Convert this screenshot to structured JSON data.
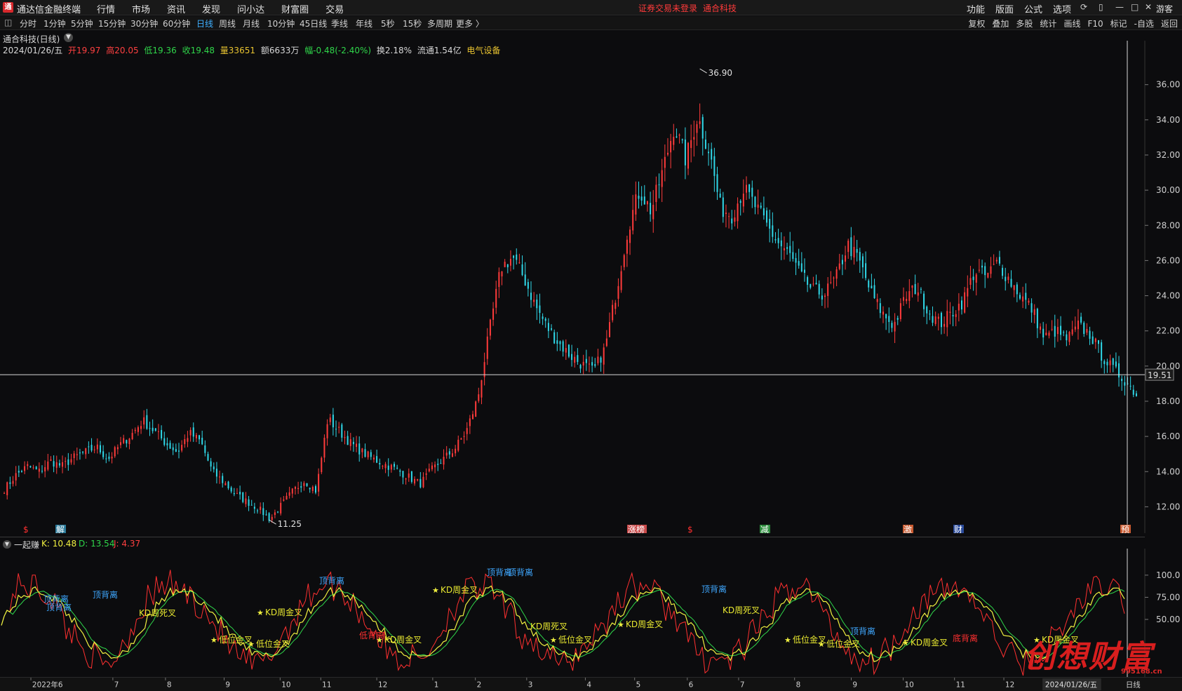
{
  "app": {
    "title": "通达信金融终端",
    "logo": "通",
    "menus": [
      "行情",
      "市场",
      "资讯",
      "发现",
      "问小达",
      "财富圈",
      "交易"
    ],
    "login_notice": "证券交易未登录",
    "stock_name": "通合科技",
    "right_menus": [
      "功能",
      "版面",
      "公式",
      "选项"
    ],
    "guest": "游客",
    "window_icons": [
      "refresh-icon",
      "phone-icon",
      "minimize-icon",
      "maximize-icon",
      "close-icon"
    ]
  },
  "toolbar": {
    "periods": [
      "分时",
      "1分钟",
      "5分钟",
      "15分钟",
      "30分钟",
      "60分钟",
      "日线",
      "周线",
      "月线",
      "10分钟",
      "45日线",
      "季线",
      "年线",
      "5秒",
      "15秒",
      "多周期",
      "更多 〉"
    ],
    "active": "日线",
    "right": [
      "复权",
      "叠加",
      "多股",
      "统计",
      "画线",
      "F10",
      "标记",
      "-自选",
      "返回"
    ]
  },
  "header": {
    "stock_title": "通合科技(日线)",
    "date": "2024/01/26/五",
    "open": "开19.97",
    "high": "高20.05",
    "low": "低19.36",
    "close": "收19.48",
    "volume": "量33651",
    "amount": "额6633万",
    "change": "幅-0.48(-2.40%)",
    "turnover": "换2.18%",
    "float": "流通1.54亿",
    "sector": "电气设备"
  },
  "chart_data": [
    {
      "type": "candlestick",
      "price_axis_ticks": [
        12,
        14,
        16,
        18,
        20,
        22,
        24,
        26,
        28,
        30,
        32,
        34,
        36
      ],
      "price_axis_labels": [
        "12.00",
        "14.00",
        "16.00",
        "18.00",
        "20.00",
        "22.00",
        "24.00",
        "26.00",
        "28.00",
        "30.00",
        "32.00",
        "34.00",
        "36.00"
      ],
      "ylim": [
        10.5,
        38.5
      ],
      "up_color": "#ff3b3b",
      "down_color": "#2fd8e8",
      "max_label": "36.90",
      "min_label": "11.25",
      "crosshair_label": "19.51",
      "crosshair_price": 19.51,
      "months": [
        "2022年6",
        "7",
        "8",
        "9",
        "10",
        "11",
        "12",
        "1",
        "2",
        "3",
        "4",
        "5",
        "6",
        "7",
        "8",
        "9",
        "10",
        "11",
        "12"
      ],
      "last_date_label": "2024/01/26/五",
      "period_label": "日线",
      "close_path": [
        13.0,
        13.8,
        14.3,
        14.0,
        14.6,
        14.3,
        14.8,
        15.1,
        15.4,
        14.7,
        15.5,
        16.1,
        16.9,
        16.3,
        15.6,
        15.1,
        16.2,
        15.7,
        14.0,
        13.4,
        12.7,
        12.3,
        11.9,
        11.3,
        12.1,
        12.9,
        13.5,
        12.9,
        17.0,
        16.3,
        15.6,
        15.1,
        14.7,
        14.4,
        14.1,
        13.7,
        13.3,
        14.1,
        14.7,
        15.3,
        16.3,
        18.2,
        22.0,
        25.6,
        26.2,
        25.0,
        23.4,
        22.2,
        21.3,
        20.6,
        20.1,
        19.7,
        21.0,
        24.3,
        27.9,
        30.0,
        28.8,
        31.1,
        33.7,
        31.7,
        34.2,
        32.3,
        29.0,
        28.6,
        30.1,
        29.1,
        28.0,
        27.0,
        26.3,
        25.1,
        24.3,
        24.1,
        25.0,
        26.9,
        26.0,
        24.2,
        23.0,
        22.3,
        23.9,
        24.5,
        23.1,
        22.4,
        23.0,
        23.7,
        25.4,
        25.1,
        25.9,
        24.9,
        24.0,
        23.2,
        21.6,
        22.0,
        21.5,
        22.3,
        21.8,
        20.6,
        19.8,
        19.2,
        18.4
      ],
      "index_labels": [
        {
          "text": "$",
          "color": "#ff3030",
          "bg": ""
        },
        {
          "text": "解",
          "color": "#ffffff",
          "bg": "#2a7a9a"
        },
        {
          "text": "涨榜",
          "color": "#ffffff",
          "bg": "#c84a4a"
        },
        {
          "text": "$",
          "color": "#ff3030",
          "bg": ""
        },
        {
          "text": "减",
          "color": "#ffffff",
          "bg": "#2a8a3a"
        },
        {
          "text": "激",
          "color": "#ffffff",
          "bg": "#c85a30"
        },
        {
          "text": "财",
          "color": "#ffffff",
          "bg": "#2a4a9a"
        },
        {
          "text": "预",
          "color": "#ffffff",
          "bg": "#c85a30"
        }
      ]
    },
    {
      "type": "line",
      "name": "一起赚",
      "series": [
        {
          "name": "K",
          "label": "K: 10.48",
          "color": "#f0f040",
          "value": 10.48
        },
        {
          "name": "D",
          "label": "D: 13.54",
          "color": "#2fd64a",
          "value": 13.54
        },
        {
          "name": "J",
          "label": "J: 4.37",
          "color": "#ff3030",
          "value": 4.37
        }
      ],
      "y_ticks": [
        50,
        75,
        100
      ],
      "y_labels": [
        "50.00",
        "75.00",
        "100.0"
      ],
      "ylim": [
        -15,
        130
      ],
      "annotations": [
        {
          "text": "顶背离",
          "color": "#3fa8ff"
        },
        {
          "text": "顶背离",
          "color": "#3fa8ff"
        },
        {
          "text": "顶背离",
          "color": "#3fa8ff"
        },
        {
          "text": "KD周死叉",
          "color": "#e8e830"
        },
        {
          "text": "低位金叉",
          "color": "#e8e830"
        },
        {
          "text": "低位金叉",
          "color": "#e8e830"
        },
        {
          "text": "KD周金叉",
          "color": "#e8e830"
        },
        {
          "text": "顶背离",
          "color": "#3fa8ff"
        },
        {
          "text": "低背离",
          "color": "#ff3030"
        },
        {
          "text": "KD周金叉",
          "color": "#e8e830"
        },
        {
          "text": "顶背离",
          "color": "#3fa8ff"
        },
        {
          "text": "顶背离",
          "color": "#3fa8ff"
        },
        {
          "text": "KD周金叉",
          "color": "#e8e830"
        },
        {
          "text": "KD周死叉",
          "color": "#e8e830"
        },
        {
          "text": "低位金叉",
          "color": "#e8e830"
        },
        {
          "text": "KD周金叉",
          "color": "#e8e830"
        },
        {
          "text": "顶背离",
          "color": "#3fa8ff"
        },
        {
          "text": "KD周死叉",
          "color": "#e8e830"
        },
        {
          "text": "低位金叉",
          "color": "#e8e830"
        },
        {
          "text": "低位金叉",
          "color": "#e8e830"
        },
        {
          "text": "顶背离",
          "color": "#3fa8ff"
        },
        {
          "text": "KD周金叉",
          "color": "#e8e830"
        },
        {
          "text": "底背离",
          "color": "#ff3030"
        },
        {
          "text": "KD周金叉",
          "color": "#e8e830"
        }
      ]
    }
  ],
  "watermark": {
    "text": "创想财富",
    "url": "995168.cn"
  }
}
